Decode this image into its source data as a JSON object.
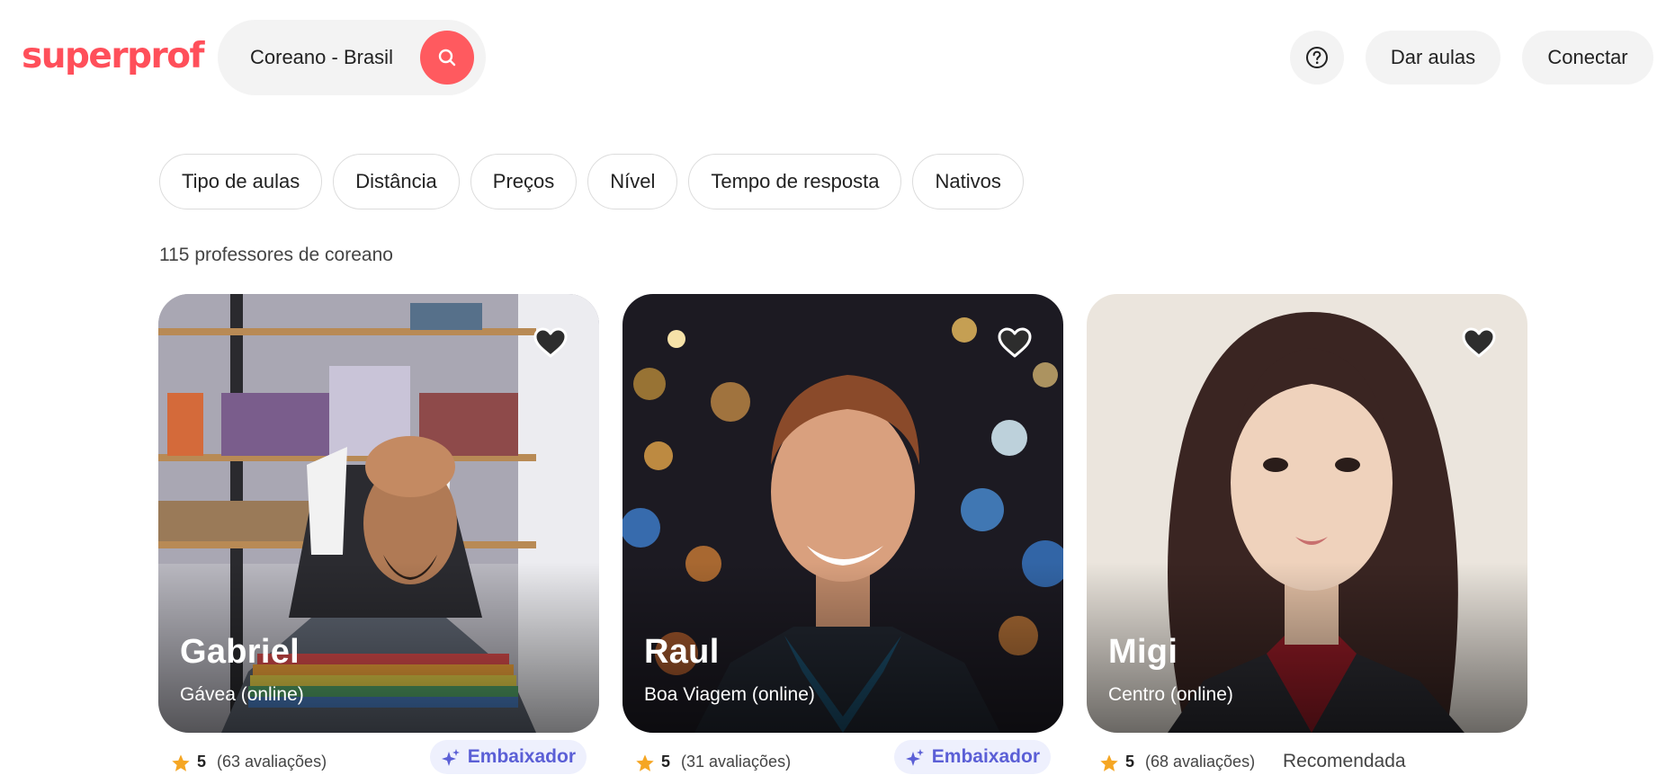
{
  "header": {
    "logo": "superprof",
    "search_value": "Coreano - Brasil",
    "teach_label": "Dar aulas",
    "login_label": "Conectar"
  },
  "filters": [
    "Tipo de aulas",
    "Distância",
    "Preços",
    "Nível",
    "Tempo de resposta",
    "Nativos"
  ],
  "results_count": "115 professores de coreano",
  "teachers": [
    {
      "name": "Gabriel",
      "location": "Gávea (online)",
      "rating": "5",
      "reviews": "(63 avaliações)",
      "badge": "Embaixador"
    },
    {
      "name": "Raul",
      "location": "Boa Viagem (online)",
      "rating": "5",
      "reviews": "(31 avaliações)",
      "badge": "Embaixador"
    },
    {
      "name": "Migi",
      "location": "Centro (online)",
      "rating": "5",
      "reviews": "(68 avaliações)",
      "badge": "Recomendada"
    }
  ],
  "icons": {
    "search": "search-icon",
    "help": "help-icon",
    "favorite": "heart-icon",
    "rating": "star-icon",
    "ambassador": "sparkle-icon"
  },
  "colors": {
    "brand": "#ff5a5f",
    "badge_text": "#5b5fd6",
    "badge_bg": "#eef0fd",
    "star": "#f5a623"
  }
}
